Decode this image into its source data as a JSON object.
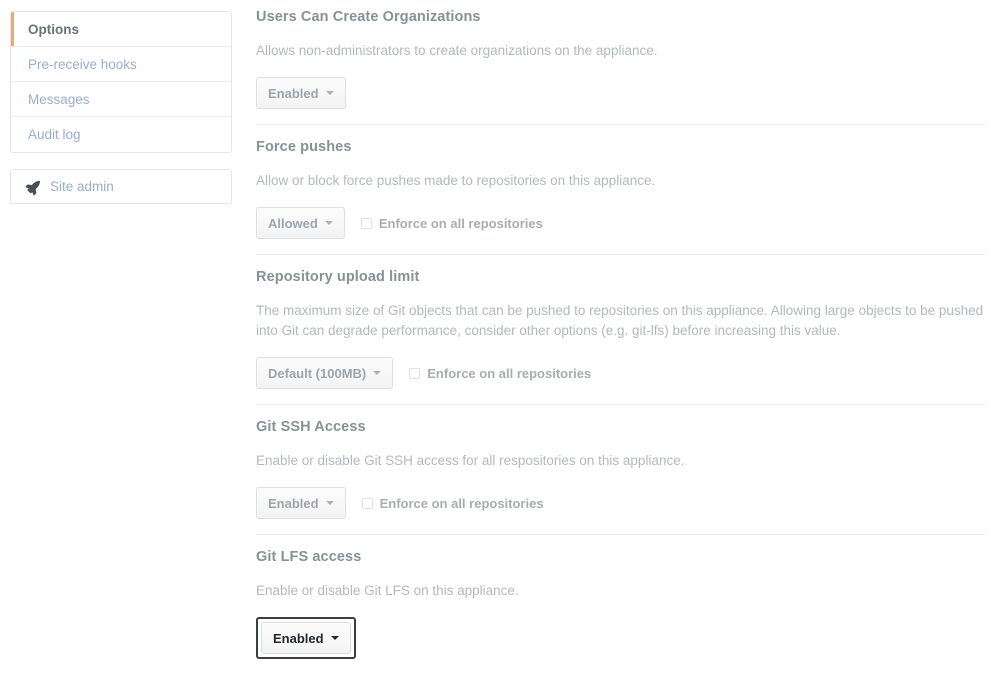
{
  "sidebar": {
    "nav_items": [
      {
        "label": "Options",
        "state": "selected"
      },
      {
        "label": "Pre-receive hooks",
        "state": "link"
      },
      {
        "label": "Messages",
        "state": "link"
      },
      {
        "label": "Audit log",
        "state": "link"
      }
    ],
    "site_admin": {
      "label": "Site admin",
      "icon": "rocket-icon"
    }
  },
  "settings": [
    {
      "title": "Users Can Create Organizations",
      "description": "Allows non-administrators to create organizations on the appliance.",
      "button": {
        "label": "Enabled",
        "icon": "chevron-down-icon",
        "focused": false
      },
      "checkbox": null
    },
    {
      "title": "Force pushes",
      "description": "Allow or block force pushes made to repositories on this appliance.",
      "button": {
        "label": "Allowed",
        "icon": "chevron-down-icon",
        "focused": false
      },
      "checkbox": {
        "label": "Enforce on all repositories",
        "checked": false
      }
    },
    {
      "title": "Repository upload limit",
      "description": "The maximum size of Git objects that can be pushed to repositories on this appliance. Allowing large objects to be pushed into Git can degrade performance, consider other options (e.g. git-lfs) before increasing this value.",
      "button": {
        "label": "Default (100MB)",
        "icon": "chevron-down-icon",
        "focused": false
      },
      "checkbox": {
        "label": "Enforce on all repositories",
        "checked": false
      }
    },
    {
      "title": "Git SSH Access",
      "description": "Enable or disable Git SSH access for all respositories on this appliance.",
      "button": {
        "label": "Enabled",
        "icon": "chevron-down-icon",
        "focused": false
      },
      "checkbox": {
        "label": "Enforce on all repositories",
        "checked": false
      }
    },
    {
      "title": "Git LFS access",
      "description": "Enable or disable Git LFS on this appliance.",
      "button": {
        "label": "Enabled",
        "icon": "chevron-down-icon",
        "focused": true
      },
      "checkbox": null
    }
  ],
  "colors": {
    "accent_selected": "#e8a87c",
    "link": "#9aadd0",
    "heading": "#8a9096",
    "description": "#b4b8bc",
    "focus_ring": "#3c3f42"
  }
}
